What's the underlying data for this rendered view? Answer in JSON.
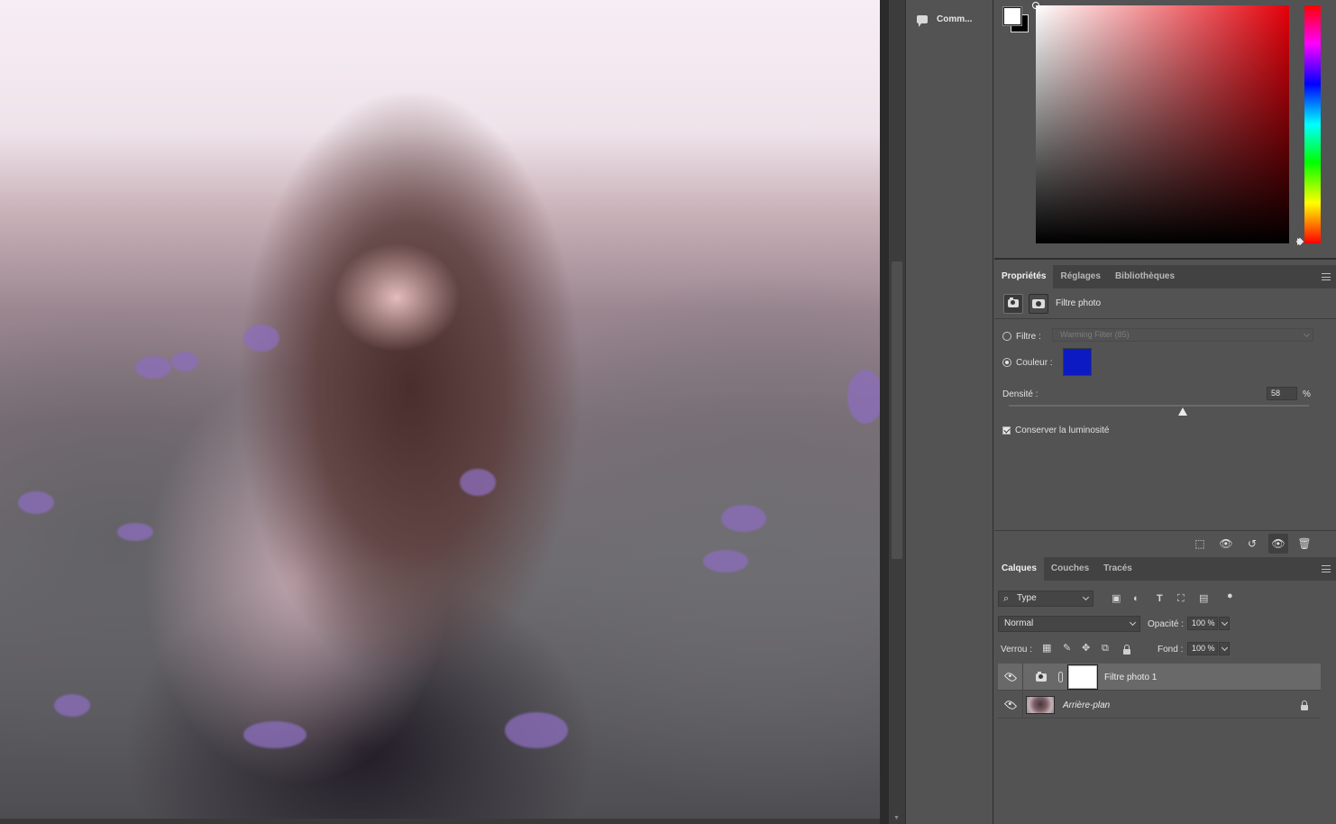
{
  "strip": {
    "comments_label": "Comm..."
  },
  "colors": {
    "foreground": "#ffffff",
    "background": "#000000",
    "hue": "#e4000a",
    "filter_color": "#0c1ac4"
  },
  "properties": {
    "tabs": [
      "Propriétés",
      "Réglages",
      "Bibliothèques"
    ],
    "title": "Filtre photo",
    "filter_label": "Filtre :",
    "filter_value": "Warming Filter (85)",
    "color_label": "Couleur :",
    "density_label": "Densité :",
    "density_value": "58",
    "density_unit": "%",
    "density_fraction": 0.58,
    "preserve_label": "Conserver la luminosité"
  },
  "layers": {
    "tabs": [
      "Calques",
      "Couches",
      "Tracés"
    ],
    "filter_kind": "Type",
    "blend_mode": "Normal",
    "opacity_label": "Opacité :",
    "opacity_value": "100 %",
    "lock_label": "Verrou :",
    "fill_label": "Fond :",
    "fill_value": "100 %",
    "items": [
      {
        "name": "Filtre photo 1",
        "selected": true
      },
      {
        "name": "Arrière-plan",
        "locked": true
      }
    ]
  }
}
